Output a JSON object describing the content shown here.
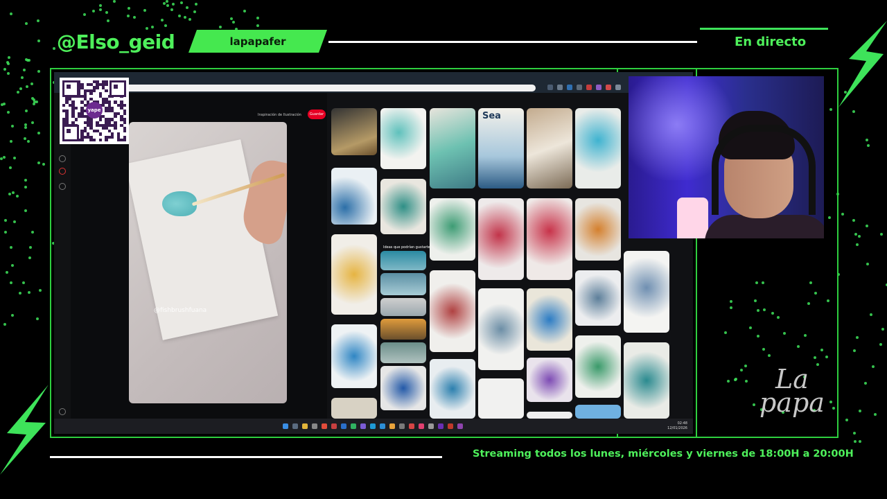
{
  "overlay": {
    "handle": "@Elso_geid",
    "name_tag": "lapapafer",
    "live_label": "En directo",
    "schedule": "Streaming todos los lunes, miércoles y viernes de 18:00H a 20:00H",
    "brand_line1": "La",
    "brand_line2": "papa",
    "accent_color": "#3ee35a"
  },
  "qr": {
    "logo_text": "yape"
  },
  "pinterest": {
    "board_title": "Inspiración de Ilustración",
    "save_label": "Guardar",
    "pin_caption": "@fishbrushfuana",
    "ideas_heading": "Ideas que podrían gustarte",
    "tile_sea_label": "Sea"
  },
  "taskbar": {
    "time": "02:48",
    "date": "12/01/2026"
  },
  "webcam": {
    "description_icon": "webcam-feed"
  }
}
